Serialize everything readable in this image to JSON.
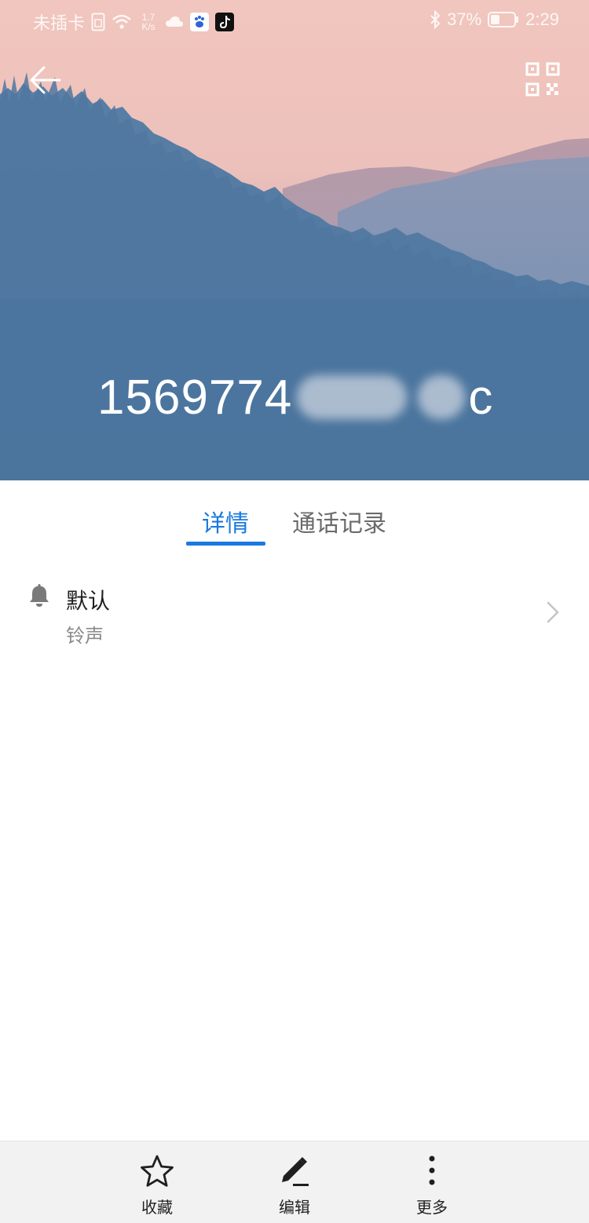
{
  "status_bar": {
    "carrier": "未插卡",
    "speed_top": "1.7",
    "speed_bottom": "K/s",
    "battery": "37%",
    "time": "2:29",
    "icons": [
      "sim-icon",
      "wifi-icon",
      "cloud-icon",
      "baidu-app-icon",
      "tiktok-app-icon",
      "bluetooth-icon",
      "battery-icon"
    ]
  },
  "header": {
    "back_icon": "back-arrow-icon",
    "qr_icon": "qr-code-icon",
    "contact_name_visible": "1569774",
    "contact_name_suffix": "c"
  },
  "tabs": [
    {
      "label": "详情",
      "active": true
    },
    {
      "label": "通话记录",
      "active": false
    }
  ],
  "details": {
    "ringtone": {
      "title": "默认",
      "subtitle": "铃声",
      "icon": "bell-icon"
    }
  },
  "bottom_bar": {
    "items": [
      {
        "label": "收藏",
        "icon": "star-icon"
      },
      {
        "label": "编辑",
        "icon": "pencil-icon"
      },
      {
        "label": "更多",
        "icon": "more-vertical-icon"
      }
    ]
  },
  "colors": {
    "accent": "#1a7ae0",
    "sky_top": "#f0c4bd",
    "forest": "#4c77a0",
    "bottom_bar_bg": "#f2f2f2"
  }
}
